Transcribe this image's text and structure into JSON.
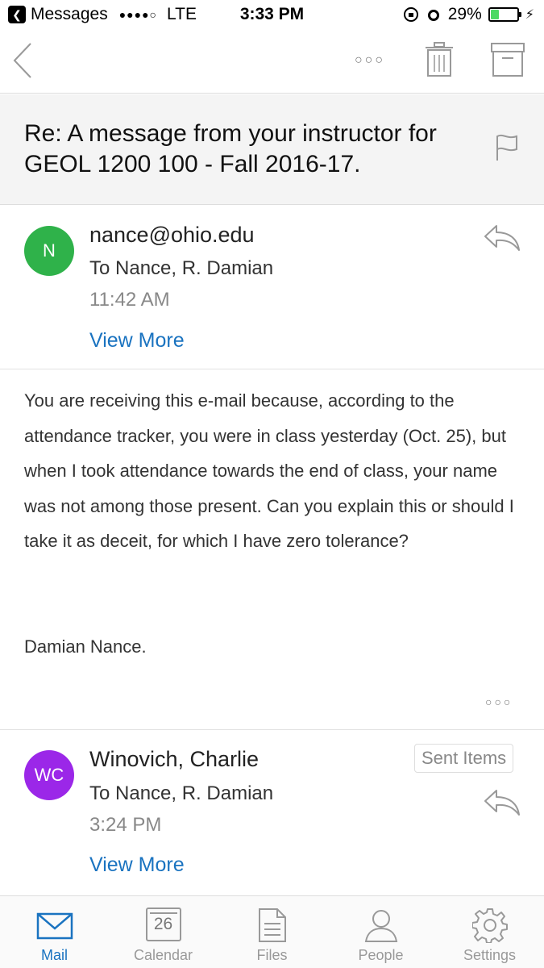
{
  "status_bar": {
    "carrier_app": "Messages",
    "signal": "●●●●○",
    "network": "LTE",
    "time": "3:33 PM",
    "battery": "29%",
    "battery_level": 0.29
  },
  "nav": {
    "more_label": "○○○"
  },
  "subject": "Re: A message from your instructor for GEOL 1200 100  - Fall 2016-17.",
  "messages": [
    {
      "avatar_initials": "N",
      "avatar_color": "#2fb24a",
      "sender": "nance@ohio.edu",
      "to": "To Nance, R. Damian",
      "time": "11:42 AM",
      "view_more": "View More",
      "body": "You are receiving this e-mail because, according to the attendance tracker, you were in class yesterday (Oct. 25), but when I took attendance towards the end of class, your name was not among those present. Can you explain this or should I take it as deceit, for which I have zero tolerance?",
      "signature": "Damian Nance."
    },
    {
      "avatar_initials": "WC",
      "avatar_color": "#9b27e8",
      "sender": "Winovich, Charlie",
      "folder_badge": "Sent Items",
      "to": "To Nance, R. Damian",
      "time": "3:24 PM",
      "view_more": "View More"
    }
  ],
  "body_more": "○○○",
  "tabs": [
    {
      "label": "Mail",
      "icon": "mail-icon",
      "active": true
    },
    {
      "label": "Calendar",
      "icon": "calendar-icon",
      "day": "26"
    },
    {
      "label": "Files",
      "icon": "files-icon"
    },
    {
      "label": "People",
      "icon": "people-icon"
    },
    {
      "label": "Settings",
      "icon": "gear-icon"
    }
  ],
  "colors": {
    "accent": "#1a73c0",
    "subject_bg": "#f4f4f4"
  }
}
